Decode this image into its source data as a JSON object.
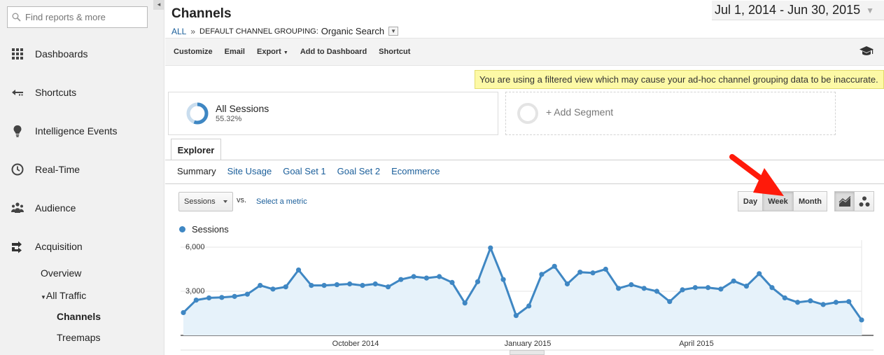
{
  "sidebar": {
    "search_placeholder": "Find reports & more",
    "items": [
      {
        "label": "Dashboards",
        "icon": "grid-icon"
      },
      {
        "label": "Shortcuts",
        "icon": "shortcut-arrow-icon"
      },
      {
        "label": "Intelligence Events",
        "icon": "lightbulb-icon"
      },
      {
        "label": "Real-Time",
        "icon": "clock-icon"
      },
      {
        "label": "Audience",
        "icon": "people-icon"
      },
      {
        "label": "Acquisition",
        "icon": "acquisition-arrows-icon"
      }
    ],
    "sub": {
      "overview": "Overview",
      "all_traffic": "All Traffic",
      "channels": "Channels",
      "treemaps": "Treemaps"
    }
  },
  "header": {
    "title": "Channels",
    "breadcrumb": {
      "all": "ALL",
      "sep": "»",
      "grouping": "DEFAULT CHANNEL GROUPING:",
      "value": "Organic Search"
    },
    "date_range": "Jul 1, 2014 - Jun 30, 2015"
  },
  "toolbar": {
    "customize": "Customize",
    "email": "Email",
    "export": "Export",
    "add_dashboard": "Add to Dashboard",
    "shortcut": "Shortcut"
  },
  "warning": "You are using a filtered view which may cause your ad-hoc channel grouping data to be inaccurate.",
  "segments": {
    "active_name": "All Sessions",
    "active_pct": "55.32%",
    "active_fraction": 0.5532,
    "add_label": "+ Add Segment"
  },
  "explorer": {
    "tab": "Explorer",
    "subtabs": [
      "Summary",
      "Site Usage",
      "Goal Set 1",
      "Goal Set 2",
      "Ecommerce"
    ]
  },
  "controls": {
    "metric": "Sessions",
    "vs": "vs.",
    "select_metric": "Select a metric",
    "granularity": [
      "Day",
      "Week",
      "Month"
    ],
    "active_granularity": "Week"
  },
  "colors": {
    "series": "#3f87c3",
    "fill": "#e6f2fa",
    "link": "#1a5e9a",
    "annotation": "#ff1a0a"
  },
  "chart_data": {
    "type": "line",
    "series": [
      {
        "name": "Sessions",
        "values": [
          1550,
          2400,
          2550,
          2580,
          2650,
          2800,
          3400,
          3150,
          3300,
          4450,
          3400,
          3400,
          3450,
          3500,
          3400,
          3500,
          3300,
          3800,
          4000,
          3900,
          4000,
          3600,
          2200,
          3650,
          5950,
          3800,
          1350,
          2000,
          4150,
          4700,
          3500,
          4300,
          4250,
          4500,
          3200,
          3450,
          3200,
          3000,
          2300,
          3100,
          3250,
          3250,
          3150,
          3700,
          3350,
          4200,
          3250,
          2550,
          2250,
          2350,
          2100,
          2250,
          2300,
          1050
        ]
      }
    ],
    "x_tick_labels": [
      "October 2014",
      "January 2015",
      "April 2015"
    ],
    "y_tick_labels": [
      "6,000",
      "3,000"
    ],
    "ylim": [
      0,
      6000
    ],
    "grid": true,
    "legend": "top-left"
  }
}
